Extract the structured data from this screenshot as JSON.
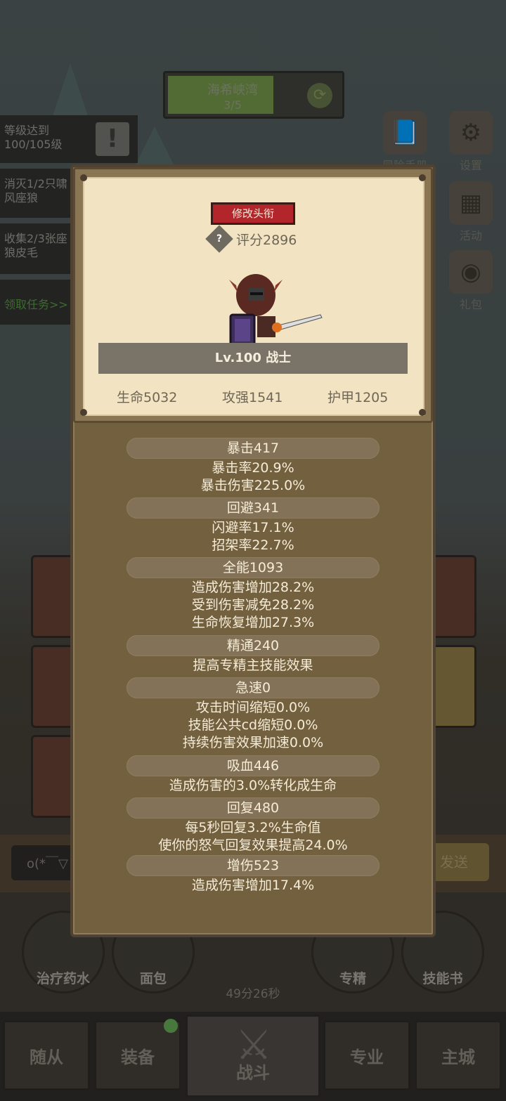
{
  "background": {
    "quest_banner": {
      "title": "海希峡湾",
      "progress": "3/5"
    },
    "tasks": [
      {
        "text": "等级达到100/105级"
      },
      {
        "text": "消灭1/2只啸风座狼"
      },
      {
        "text": "收集2/3张座狼皮毛"
      }
    ],
    "claim_tasks": "领取任务>>",
    "side_icons": [
      {
        "label": "冒险手册",
        "icon": "book-icon"
      },
      {
        "label": "设置",
        "icon": "gear-icon"
      },
      {
        "label": "活动",
        "icon": "calendar-icon"
      },
      {
        "label": "礼包",
        "icon": "gift-icon"
      }
    ],
    "chat": {
      "emoticon": "o(*￣▽",
      "send": "发送"
    },
    "consumables": [
      {
        "label": "治疗药水"
      },
      {
        "label": "面包"
      },
      {
        "label": "专精"
      },
      {
        "label": "技能书"
      }
    ],
    "timer": "49分26秒",
    "nav": [
      {
        "label": "随从"
      },
      {
        "label": "装备"
      },
      {
        "label": "战斗"
      },
      {
        "label": "专业"
      },
      {
        "label": "主城"
      }
    ]
  },
  "profile": {
    "edit_title": "修改头衔",
    "help": "?",
    "score": "评分2896",
    "level_class": "Lv.100 战士",
    "hp": "生命5032",
    "attack": "攻强1541",
    "armor": "护甲1205"
  },
  "stats": [
    {
      "head": "暴击417",
      "lines": [
        "暴击率20.9%",
        "暴击伤害225.0%"
      ]
    },
    {
      "head": "回避341",
      "lines": [
        "闪避率17.1%",
        "招架率22.7%"
      ]
    },
    {
      "head": "全能1093",
      "lines": [
        "造成伤害增加28.2%",
        "受到伤害减免28.2%",
        "生命恢复增加27.3%"
      ]
    },
    {
      "head": "精通240",
      "lines": [
        "提高专精主技能效果"
      ]
    },
    {
      "head": "急速0",
      "lines": [
        "攻击时间缩短0.0%",
        "技能公共cd缩短0.0%",
        "持续伤害效果加速0.0%"
      ]
    },
    {
      "head": "吸血446",
      "lines": [
        "造成伤害的3.0%转化成生命"
      ]
    },
    {
      "head": "回复480",
      "lines": [
        "每5秒回复3.2%生命值",
        "使你的怒气回复效果提高24.0%"
      ]
    },
    {
      "head": "增伤523",
      "lines": [
        "造成伤害增加17.4%"
      ]
    }
  ]
}
